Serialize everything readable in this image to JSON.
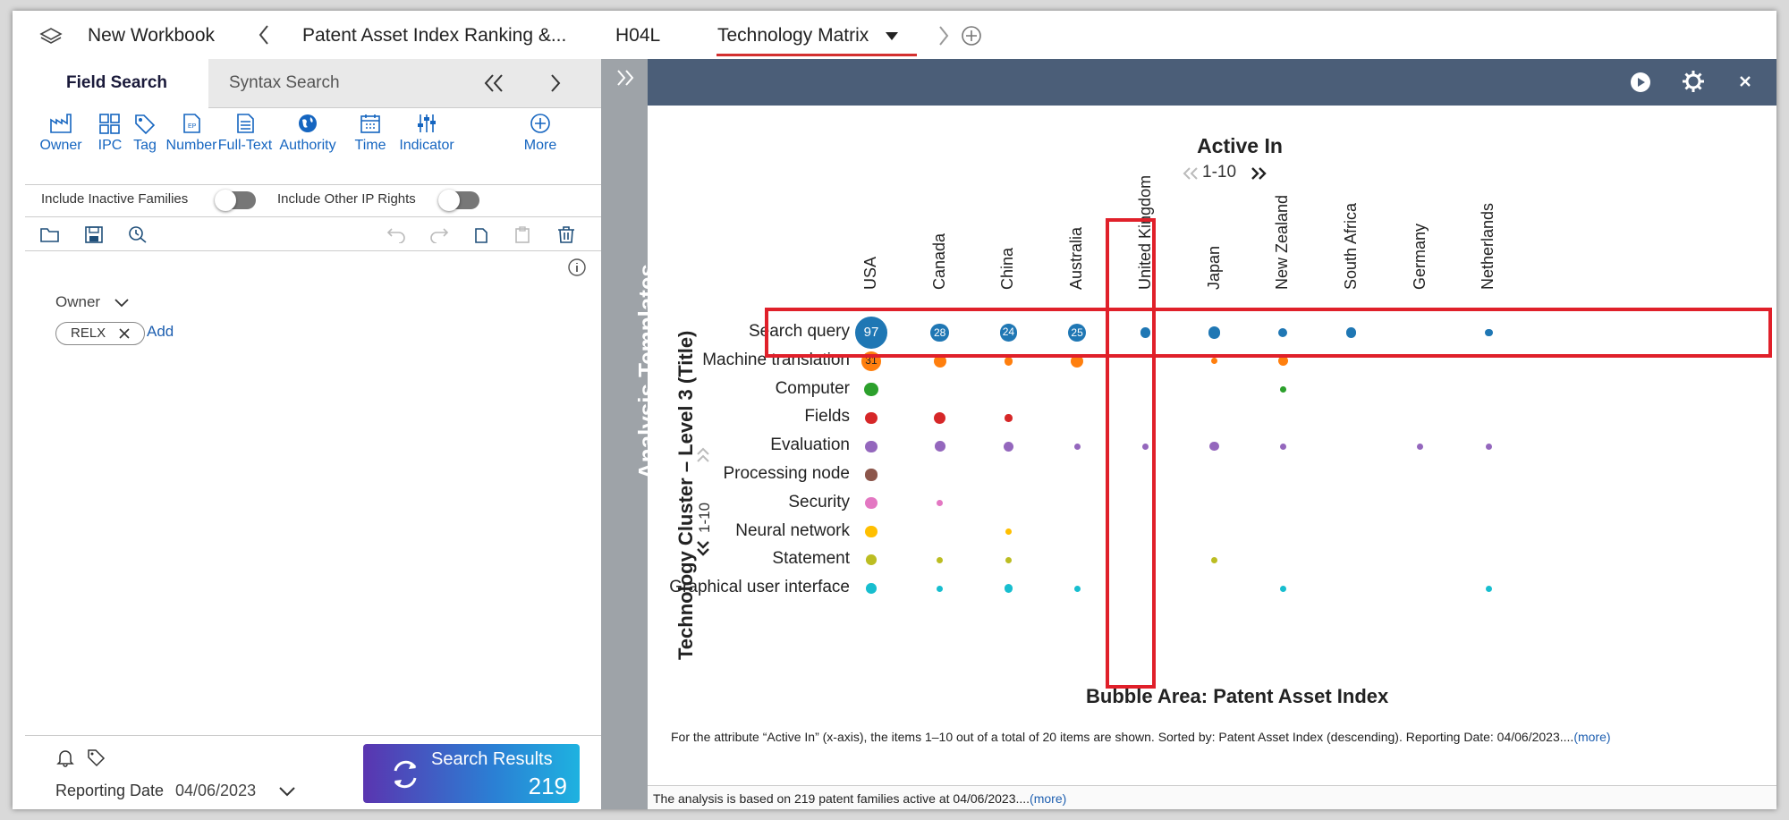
{
  "workbook": {
    "title": "New Workbook",
    "tabs": [
      "Patent Asset Index Ranking &...",
      "H04L",
      "Technology Matrix"
    ]
  },
  "left_panel": {
    "tab_field_search": "Field Search",
    "tab_syntax_search": "Syntax Search",
    "tools": [
      "Owner",
      "IPC",
      "Tag",
      "Number",
      "Full-Text",
      "Authority",
      "Time",
      "Indicator",
      "More"
    ],
    "toggle_inactive": "Include Inactive Families",
    "toggle_other_ip": "Include Other IP Rights",
    "owner_label": "Owner",
    "chip": "RELX",
    "add_label": "Add",
    "reporting_label": "Reporting Date",
    "reporting_date": "04/06/2023",
    "search_results_label": "Search Results",
    "search_results_count": "219"
  },
  "side_label": "Analysis Templates",
  "chart": {
    "title": "Active In",
    "pager_x": "1-10",
    "pager_y": "1-10",
    "ylabel": "Technology Cluster – Level 3 (Title)",
    "bubble_area": "Bubble Area:  Patent Asset Index",
    "footnote": "For the attribute “Active In” (x-axis), the items 1–10 out of a total of 20 items are shown. Sorted by: Patent Asset Index (descending). Reporting Date: 04/06/2023....",
    "footnote_more": "(more)",
    "bottom_note": "The analysis is based on 219 patent families active at 04/06/2023....",
    "bottom_more": "(more)"
  },
  "chart_data": {
    "type": "scatter",
    "x_categories": [
      "USA",
      "Canada",
      "China",
      "Australia",
      "United Kingdom",
      "Japan",
      "New Zealand",
      "South Africa",
      "Germany",
      "Netherlands"
    ],
    "y_categories": [
      "Search query",
      "Machine translation",
      "Computer",
      "Fields",
      "Evaluation",
      "Processing node",
      "Security",
      "Neural network",
      "Statement",
      "Graphical user interface"
    ],
    "colors": [
      "#1f77b4",
      "#ff7f0e",
      "#2ca02c",
      "#d62728",
      "#9467bd",
      "#8c564b",
      "#e377c2",
      "#ffbf00",
      "#bcbd22",
      "#17becf"
    ],
    "labels": {
      "0,0": "97",
      "0,1": "28",
      "0,2": "24",
      "0,3": "25",
      "1,0": "31"
    },
    "points": [
      [
        0,
        0,
        97
      ],
      [
        0,
        1,
        28
      ],
      [
        0,
        2,
        24
      ],
      [
        0,
        3,
        25
      ],
      [
        0,
        4,
        5
      ],
      [
        0,
        5,
        8
      ],
      [
        0,
        6,
        4
      ],
      [
        0,
        7,
        5
      ],
      [
        0,
        9,
        2
      ],
      [
        1,
        0,
        31
      ],
      [
        1,
        1,
        10
      ],
      [
        1,
        2,
        3
      ],
      [
        1,
        3,
        10
      ],
      [
        1,
        5,
        1
      ],
      [
        1,
        6,
        5
      ],
      [
        2,
        0,
        13
      ],
      [
        2,
        6,
        0.8
      ],
      [
        3,
        0,
        9
      ],
      [
        3,
        1,
        8
      ],
      [
        3,
        2,
        2
      ],
      [
        4,
        0,
        8
      ],
      [
        4,
        1,
        6
      ],
      [
        4,
        2,
        5
      ],
      [
        4,
        3,
        1
      ],
      [
        4,
        4,
        1
      ],
      [
        4,
        5,
        4
      ],
      [
        4,
        6,
        1
      ],
      [
        4,
        8,
        1
      ],
      [
        4,
        9,
        1
      ],
      [
        5,
        0,
        8
      ],
      [
        6,
        0,
        8
      ],
      [
        6,
        1,
        1
      ],
      [
        7,
        0,
        8
      ],
      [
        7,
        2,
        1
      ],
      [
        8,
        0,
        6
      ],
      [
        8,
        1,
        1
      ],
      [
        8,
        2,
        1
      ],
      [
        8,
        5,
        1
      ],
      [
        9,
        0,
        6
      ],
      [
        9,
        1,
        1
      ],
      [
        9,
        2,
        3
      ],
      [
        9,
        3,
        1
      ],
      [
        9,
        6,
        1
      ],
      [
        9,
        9,
        1
      ]
    ]
  }
}
